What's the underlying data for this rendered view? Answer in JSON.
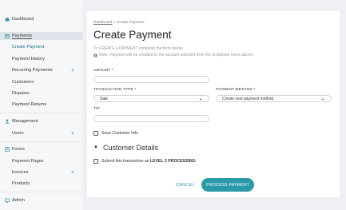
{
  "sidebar": {
    "dashboard": {
      "label": "Dashboard"
    },
    "payments": {
      "label": "Payments"
    },
    "payment_items": [
      {
        "label": "Create Payment"
      },
      {
        "label": "Payment History"
      },
      {
        "label": "Recurring Payments"
      },
      {
        "label": "Customers"
      },
      {
        "label": "Disputes"
      },
      {
        "label": "Payment Returns"
      }
    ],
    "management": {
      "label": "Management"
    },
    "management_items": [
      {
        "label": "Users"
      }
    ],
    "forms": {
      "label": "Forms"
    },
    "forms_items": [
      {
        "label": "Payment Pages"
      },
      {
        "label": "Invoices"
      },
      {
        "label": "Products"
      }
    ],
    "admin": {
      "label": "Admin"
    },
    "plus": "+"
  },
  "main": {
    "breadcrumb": {
      "root": "Dashboard",
      "separator": " > ",
      "current": "Create Payment"
    },
    "title": "Create Payment",
    "intro_line1": "To CREATE a PAYMENT complete the form below.",
    "intro_line2": "Note: Payment will be credited to the account selected from the dropdown menu above.",
    "amount_label": "AMOUNT *",
    "transaction_type_label": "TRANSACTION TYPE *",
    "transaction_type_value": "Sale",
    "payment_method_label": "PAYMENT METHOD *",
    "payment_method_value": "Create new payment method",
    "tip_label": "TIP",
    "save_customer_label": "Save Customer Info",
    "customer_details_label": "Customer Details",
    "level2_prefix": "Submit this transaction as ",
    "level2_bold": "LEVEL 2 PROCESSING",
    "cancel_label": "CANCEL",
    "submit_label": "PROCESS PAYMENT"
  },
  "colors": {
    "accent": "#2a9aa8",
    "background": "#eef0f3",
    "sidebar": "#f6f7f9"
  },
  "icons": {
    "dashboard": "dashboard-icon",
    "payments": "credit-card-icon",
    "management": "user-icon",
    "forms": "form-icon",
    "admin": "admin-icon",
    "info": "info-icon",
    "caret": "chevron-down-icon",
    "collapse": "triangle-down-icon"
  }
}
